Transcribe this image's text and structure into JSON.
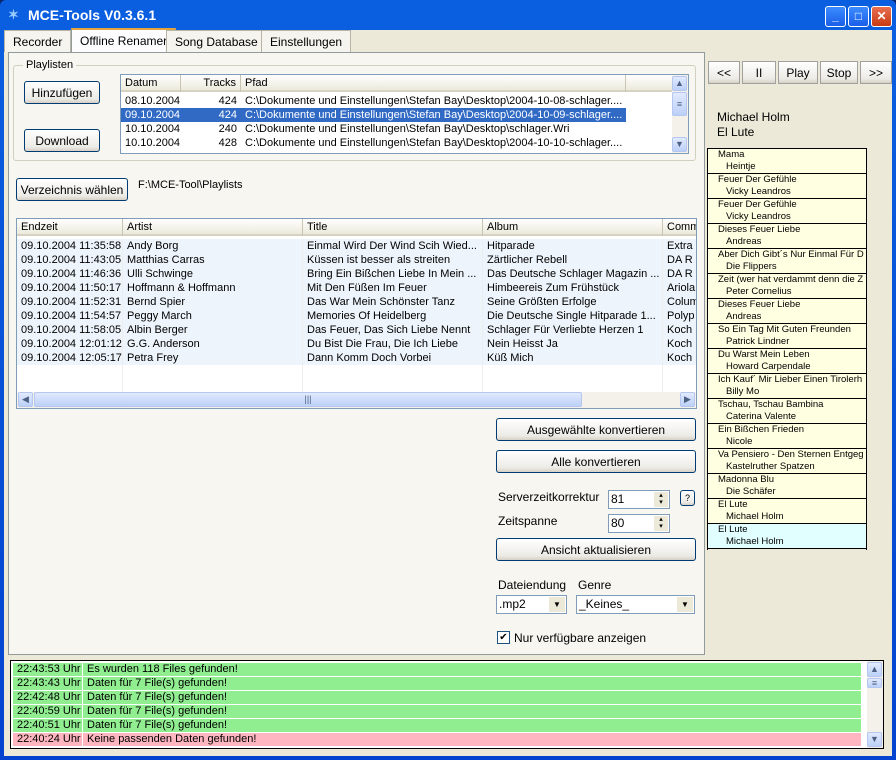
{
  "window": {
    "title": "MCE-Tools V0.3.6.1",
    "min": "_",
    "max": "□",
    "close": "✕"
  },
  "tabs": [
    {
      "label": "Recorder"
    },
    {
      "label": "Offline Renamer"
    },
    {
      "label": "Song Database"
    },
    {
      "label": "Einstellungen"
    }
  ],
  "playlists": {
    "group_label": "Playlisten",
    "add_button": "Hinzufügen",
    "download_button": "Download",
    "columns": [
      "Datum",
      "Tracks",
      "Pfad"
    ],
    "rows": [
      {
        "datum": "08.10.2004",
        "tracks": "424",
        "pfad": "C:\\Dokumente und Einstellungen\\Stefan Bay\\Desktop\\2004-10-08-schlager...."
      },
      {
        "datum": "09.10.2004",
        "tracks": "424",
        "pfad": "C:\\Dokumente und Einstellungen\\Stefan Bay\\Desktop\\2004-10-09-schlager...."
      },
      {
        "datum": "10.10.2004",
        "tracks": "240",
        "pfad": "C:\\Dokumente und Einstellungen\\Stefan Bay\\Desktop\\schlager.Wri"
      },
      {
        "datum": "10.10.2004",
        "tracks": "428",
        "pfad": "C:\\Dokumente und Einstellungen\\Stefan Bay\\Desktop\\2004-10-10-schlager...."
      }
    ],
    "selected_index": 1
  },
  "directory": {
    "button": "Verzeichnis wählen",
    "path": "F:\\MCE-Tool\\Playlists"
  },
  "tracks": {
    "columns": [
      "Endzeit",
      "Artist",
      "Title",
      "Album",
      "Comm"
    ],
    "rows": [
      [
        "09.10.2004 11:35:58",
        "Andy Borg",
        "Einmal Wird Der Wind Scih Wied...",
        "Hitparade",
        "Extra"
      ],
      [
        "09.10.2004 11:43:05",
        "Matthias Carras",
        "Küssen ist besser als streiten",
        "Zärtlicher Rebell",
        "DA R"
      ],
      [
        "09.10.2004 11:46:36",
        "Ulli Schwinge",
        "Bring Ein Bißchen Liebe In Mein ...",
        "Das Deutsche Schlager Magazin ...",
        "DA R"
      ],
      [
        "09.10.2004 11:50:17",
        "Hoffmann & Hoffmann",
        "Mit Den Füßen Im Feuer",
        "Himbeereis Zum Frühstück",
        "Ariola"
      ],
      [
        "09.10.2004 11:52:31",
        "Bernd Spier",
        "Das War Mein Schönster Tanz",
        "Seine Größten Erfolge",
        "Colum"
      ],
      [
        "09.10.2004 11:54:57",
        "Peggy March",
        "Memories Of Heidelberg",
        "Die Deutsche Single Hitparade 1...",
        "Polyp"
      ],
      [
        "09.10.2004 11:58:05",
        "Albin Berger",
        "Das Feuer, Das Sich Liebe Nennt",
        "Schlager Für Verliebte Herzen 1",
        "Koch"
      ],
      [
        "09.10.2004 12:01:12",
        "G.G. Anderson",
        "Du Bist Die Frau, Die Ich Liebe",
        "Nein Heisst Ja",
        "Koch"
      ],
      [
        "09.10.2004 12:05:17",
        "Petra Frey",
        "Dann Komm Doch Vorbei",
        "Küß Mich",
        "Koch"
      ]
    ]
  },
  "actions": {
    "convert_selected": "Ausgewählte konvertieren",
    "convert_all": "Alle konvertieren",
    "server_time_label": "Serverzeitkorrektur",
    "server_time_value": "81",
    "help": "?",
    "timespan_label": "Zeitspanne",
    "timespan_value": "80",
    "refresh": "Ansicht aktualisieren",
    "ext_label": "Dateiendung",
    "ext_value": ".mp2",
    "genre_label": "Genre",
    "genre_value": "_Keines_",
    "only_available_label": "Nur verfügbare anzeigen",
    "only_available_checked": true
  },
  "player": {
    "buttons": [
      "<<",
      "II",
      "Play",
      "Stop",
      ">>"
    ],
    "now_artist": "Michael Holm",
    "now_title": "El Lute",
    "queue": [
      {
        "t": "Mama",
        "a": "Heintje"
      },
      {
        "t": "Feuer Der Gefühle",
        "a": "Vicky Leandros"
      },
      {
        "t": "Feuer Der Gefühle",
        "a": "Vicky Leandros"
      },
      {
        "t": "Dieses Feuer Liebe",
        "a": "Andreas"
      },
      {
        "t": "Aber Dich Gibt´s Nur Einmal Für D",
        "a": "Die Flippers"
      },
      {
        "t": "Zeit (wer hat verdammt denn die Z",
        "a": "Peter Cornelius"
      },
      {
        "t": "Dieses Feuer Liebe",
        "a": "Andreas"
      },
      {
        "t": "So Ein Tag Mit Guten Freunden",
        "a": "Patrick Lindner"
      },
      {
        "t": "Du Warst Mein Leben",
        "a": "Howard Carpendale"
      },
      {
        "t": "Ich Kauf´ Mir Lieber Einen Tirolerh",
        "a": "Billy Mo"
      },
      {
        "t": "Tschau, Tschau Bambina",
        "a": "Caterina Valente"
      },
      {
        "t": "Ein Bißchen Frieden",
        "a": "Nicole"
      },
      {
        "t": "Va Pensiero - Den Sternen Entgeg",
        "a": "Kastelruther Spatzen"
      },
      {
        "t": "Madonna Blu",
        "a": "Die Schäfer"
      },
      {
        "t": "El Lute",
        "a": "Michael Holm"
      },
      {
        "t": "El Lute",
        "a": "Michael Holm"
      }
    ],
    "current_index": 15,
    "colors": {
      "item": "#ffffe1",
      "current": "#e1ffff"
    }
  },
  "log": {
    "rows": [
      {
        "time": "22:43:53 Uhr",
        "msg": "Es wurden 118 Files gefunden!",
        "status": "ok"
      },
      {
        "time": "22:43:43 Uhr",
        "msg": "Daten für 7 File(s) gefunden!",
        "status": "ok"
      },
      {
        "time": "22:42:48 Uhr",
        "msg": "Daten für 7 File(s) gefunden!",
        "status": "ok"
      },
      {
        "time": "22:40:59 Uhr",
        "msg": "Daten für 7 File(s) gefunden!",
        "status": "ok"
      },
      {
        "time": "22:40:51 Uhr",
        "msg": "Daten für 7 File(s) gefunden!",
        "status": "ok"
      },
      {
        "time": "22:40:24 Uhr",
        "msg": "Keine passenden Daten gefunden!",
        "status": "error"
      }
    ],
    "colors": {
      "ok": "#90ee90",
      "error": "#ffb6c1"
    }
  }
}
